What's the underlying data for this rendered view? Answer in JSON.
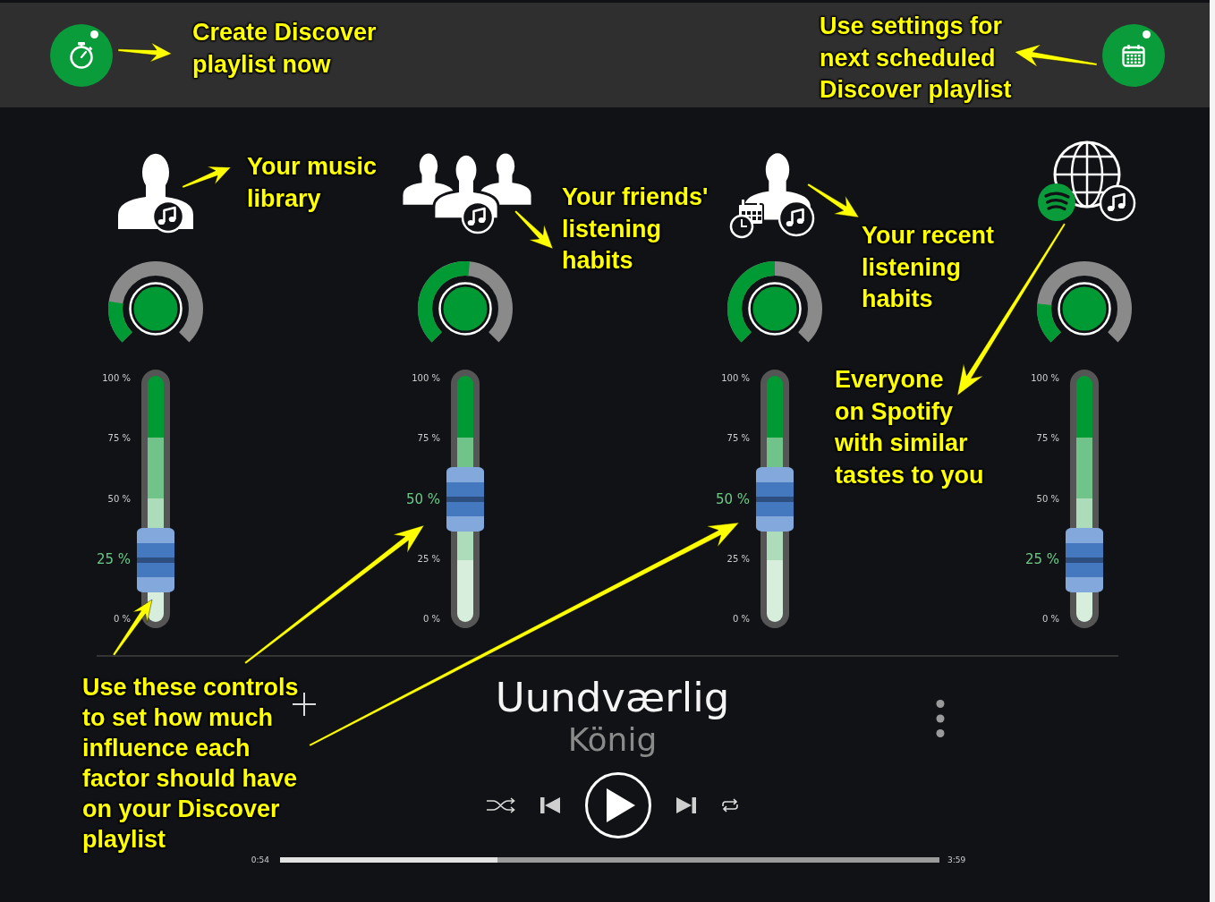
{
  "callouts": [
    {
      "text": "Create Discover\nplaylist now"
    },
    {
      "text": "Use settings for\nnext scheduled\nDiscover playlist"
    },
    {
      "text": "Your music\nlibrary"
    },
    {
      "text": "Your friends'\nlistening\nhabits"
    },
    {
      "text": "Your recent\nlistening\nhabits"
    },
    {
      "text": "Everyone\non Spotify\nwith similar\ntastes to you"
    },
    {
      "text": "Use these controls\nto set how much\ninfluence each\nfactor should have\non your Discover\nplaylist"
    }
  ],
  "mixer": {
    "channels": [
      {
        "kind": "library",
        "knob": {
          "level": 0.2
        },
        "slider": {
          "level": 0.25,
          "ticks": [
            {
              "label": "100 %",
              "selected": false
            },
            {
              "label": "75 %",
              "selected": false
            },
            {
              "label": "50 %",
              "selected": false
            },
            {
              "label": "25 %",
              "selected": true
            },
            {
              "label": "0 %",
              "selected": false
            }
          ]
        }
      },
      {
        "kind": "friends",
        "knob": {
          "level": 0.52
        },
        "slider": {
          "level": 0.5,
          "ticks": [
            {
              "label": "100 %",
              "selected": false
            },
            {
              "label": "75 %",
              "selected": false
            },
            {
              "label": "50 %",
              "selected": true
            },
            {
              "label": "25 %",
              "selected": false
            },
            {
              "label": "0 %",
              "selected": false
            }
          ]
        }
      },
      {
        "kind": "recent",
        "knob": {
          "level": 0.5
        },
        "slider": {
          "level": 0.5,
          "ticks": [
            {
              "label": "100 %",
              "selected": false
            },
            {
              "label": "75 %",
              "selected": false
            },
            {
              "label": "50 %",
              "selected": true
            },
            {
              "label": "25 %",
              "selected": false
            },
            {
              "label": "0 %",
              "selected": false
            }
          ]
        }
      },
      {
        "kind": "everyone",
        "knob": {
          "level": 0.19
        },
        "slider": {
          "level": 0.25,
          "ticks": [
            {
              "label": "100 %",
              "selected": false
            },
            {
              "label": "75 %",
              "selected": false
            },
            {
              "label": "50 %",
              "selected": false
            },
            {
              "label": "25 %",
              "selected": true
            },
            {
              "label": "0 %",
              "selected": false
            }
          ]
        }
      }
    ]
  },
  "player": {
    "title": "Uundværlig",
    "artist": "König",
    "elapsed": "0:54",
    "duration": "3:59",
    "progress": {
      "level": 0.33
    }
  }
}
